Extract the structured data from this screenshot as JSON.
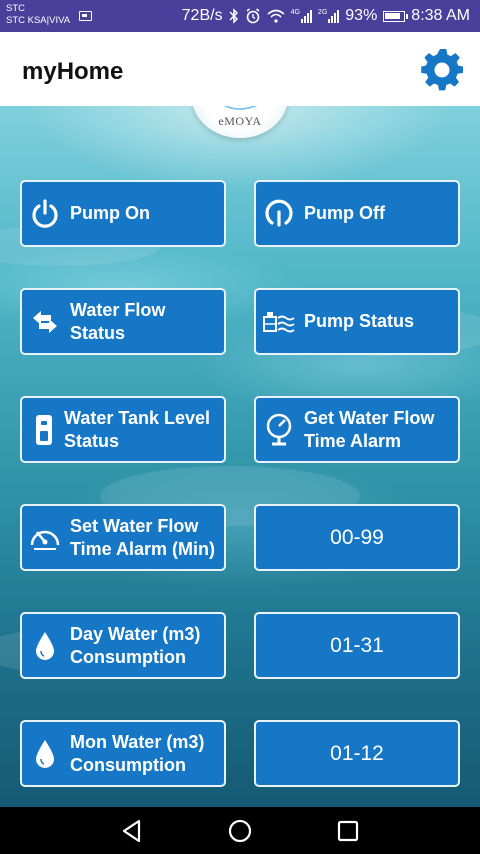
{
  "status_bar": {
    "carrier_line1": "STC",
    "carrier_line2": "STC KSA|VIVA",
    "net_speed": "72B/s",
    "net_type_1": "4G",
    "net_type_2": "2G",
    "battery": "93%",
    "time": "8:38 AM",
    "icons": [
      "sim-icon",
      "bluetooth-icon",
      "alarm-icon",
      "wifi-icon",
      "signal-icon",
      "battery-icon"
    ]
  },
  "app_bar": {
    "title": "myHome",
    "settings_icon": "gear-icon",
    "accent": "#1577c6"
  },
  "logo": {
    "text": "eMOYA"
  },
  "buttons": [
    {
      "label": "Pump On",
      "icon": "power-icon"
    },
    {
      "label": "Pump Off",
      "icon": "power-off-icon"
    },
    {
      "label": "Water Flow Status",
      "icon": "flow-arrows-icon"
    },
    {
      "label": "Pump Status",
      "icon": "pump-icon"
    },
    {
      "label": "Water Tank Level Status",
      "icon": "tank-icon"
    },
    {
      "label": "Get Water Flow Time Alarm",
      "icon": "gauge-icon"
    },
    {
      "label": "Set Water Flow Time Alarm (Min)",
      "icon": "speedometer-icon"
    },
    {
      "label": "00-99",
      "icon": null
    },
    {
      "label": "Day Water (m3) Consumption",
      "icon": "water-drop-icon"
    },
    {
      "label": "01-31",
      "icon": null
    },
    {
      "label": "Mon Water (m3) Consumption",
      "icon": "water-drop-icon"
    },
    {
      "label": "01-12",
      "icon": null
    }
  ],
  "nav_bar": {
    "icons": [
      "back-icon",
      "home-icon",
      "recents-icon"
    ]
  }
}
